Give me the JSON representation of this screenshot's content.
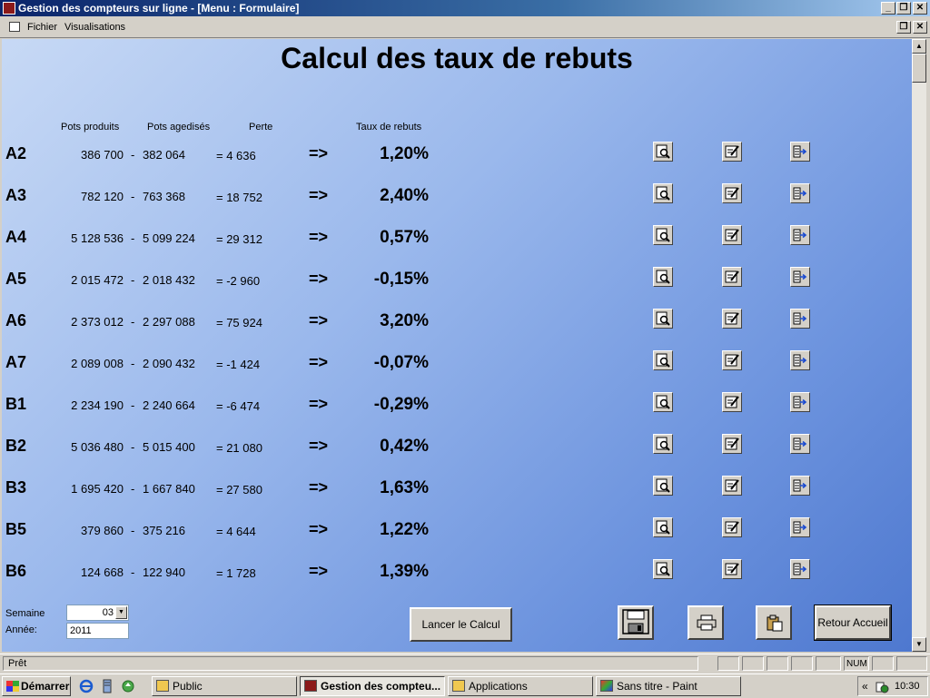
{
  "window": {
    "title": "Gestion des compteurs sur ligne - [Menu : Formulaire]"
  },
  "menu": {
    "items": [
      "Fichier",
      "Visualisations"
    ]
  },
  "form": {
    "title": "Calcul des taux de rebuts",
    "headers": {
      "produced": "Pots produits",
      "aged": "Pots agedisés",
      "loss": "Perte",
      "rate": "Taux de rebuts"
    },
    "rows": [
      {
        "code": "A2",
        "produced": "386 700",
        "minus": "-",
        "aged": "382 064",
        "loss": "= 4 636",
        "arrow": "=>",
        "rate": "1,20%"
      },
      {
        "code": "A3",
        "produced": "782 120",
        "minus": "-",
        "aged": "763 368",
        "loss": "= 18 752",
        "arrow": "=>",
        "rate": "2,40%"
      },
      {
        "code": "A4",
        "produced": "5 128 536",
        "minus": "-",
        "aged": "5 099 224",
        "loss": "= 29 312",
        "arrow": "=>",
        "rate": "0,57%"
      },
      {
        "code": "A5",
        "produced": "2 015 472",
        "minus": "-",
        "aged": "2 018 432",
        "loss": "= -2 960",
        "arrow": "=>",
        "rate": "-0,15%"
      },
      {
        "code": "A6",
        "produced": "2 373 012",
        "minus": "-",
        "aged": "2 297 088",
        "loss": "= 75 924",
        "arrow": "=>",
        "rate": "3,20%"
      },
      {
        "code": "A7",
        "produced": "2 089 008",
        "minus": "-",
        "aged": "2 090 432",
        "loss": "= -1 424",
        "arrow": "=>",
        "rate": "-0,07%"
      },
      {
        "code": "B1",
        "produced": "2 234 190",
        "minus": "-",
        "aged": "2 240 664",
        "loss": "= -6 474",
        "arrow": "=>",
        "rate": "-0,29%"
      },
      {
        "code": "B2",
        "produced": "5 036 480",
        "minus": "-",
        "aged": "5 015 400",
        "loss": "= 21 080",
        "arrow": "=>",
        "rate": "0,42%"
      },
      {
        "code": "B3",
        "produced": "1 695 420",
        "minus": "-",
        "aged": "1 667 840",
        "loss": "= 27 580",
        "arrow": "=>",
        "rate": "1,63%"
      },
      {
        "code": "B5",
        "produced": "379 860",
        "minus": "-",
        "aged": "375 216",
        "loss": "= 4 644",
        "arrow": "=>",
        "rate": "1,22%"
      },
      {
        "code": "B6",
        "produced": "124 668",
        "minus": "-",
        "aged": "122 940",
        "loss": "= 1 728",
        "arrow": "=>",
        "rate": "1,39%"
      }
    ],
    "row_icons": [
      "preview-icon",
      "edit-icon",
      "export-icon"
    ],
    "week_label": "Semaine",
    "week_value": "03",
    "year_label": "Année:",
    "year_value": "2011",
    "calc_button": "Lancer le Calcul",
    "home_button": "Retour Accueil",
    "tool_icons": [
      "save-icon",
      "print-icon",
      "clipboard-icon"
    ]
  },
  "status": {
    "text": "Prêt",
    "num": "NUM"
  },
  "taskbar": {
    "start": "Démarrer",
    "tasks": [
      {
        "label": "Public",
        "icon": "folder-icon",
        "active": false
      },
      {
        "label": "Gestion des compteu...",
        "icon": "access-icon",
        "active": true
      },
      {
        "label": "Applications",
        "icon": "folder-icon",
        "active": false
      },
      {
        "label": "Sans titre - Paint",
        "icon": "paint-icon",
        "active": false
      }
    ],
    "clock": "10:30",
    "tray_chevron": "«"
  }
}
